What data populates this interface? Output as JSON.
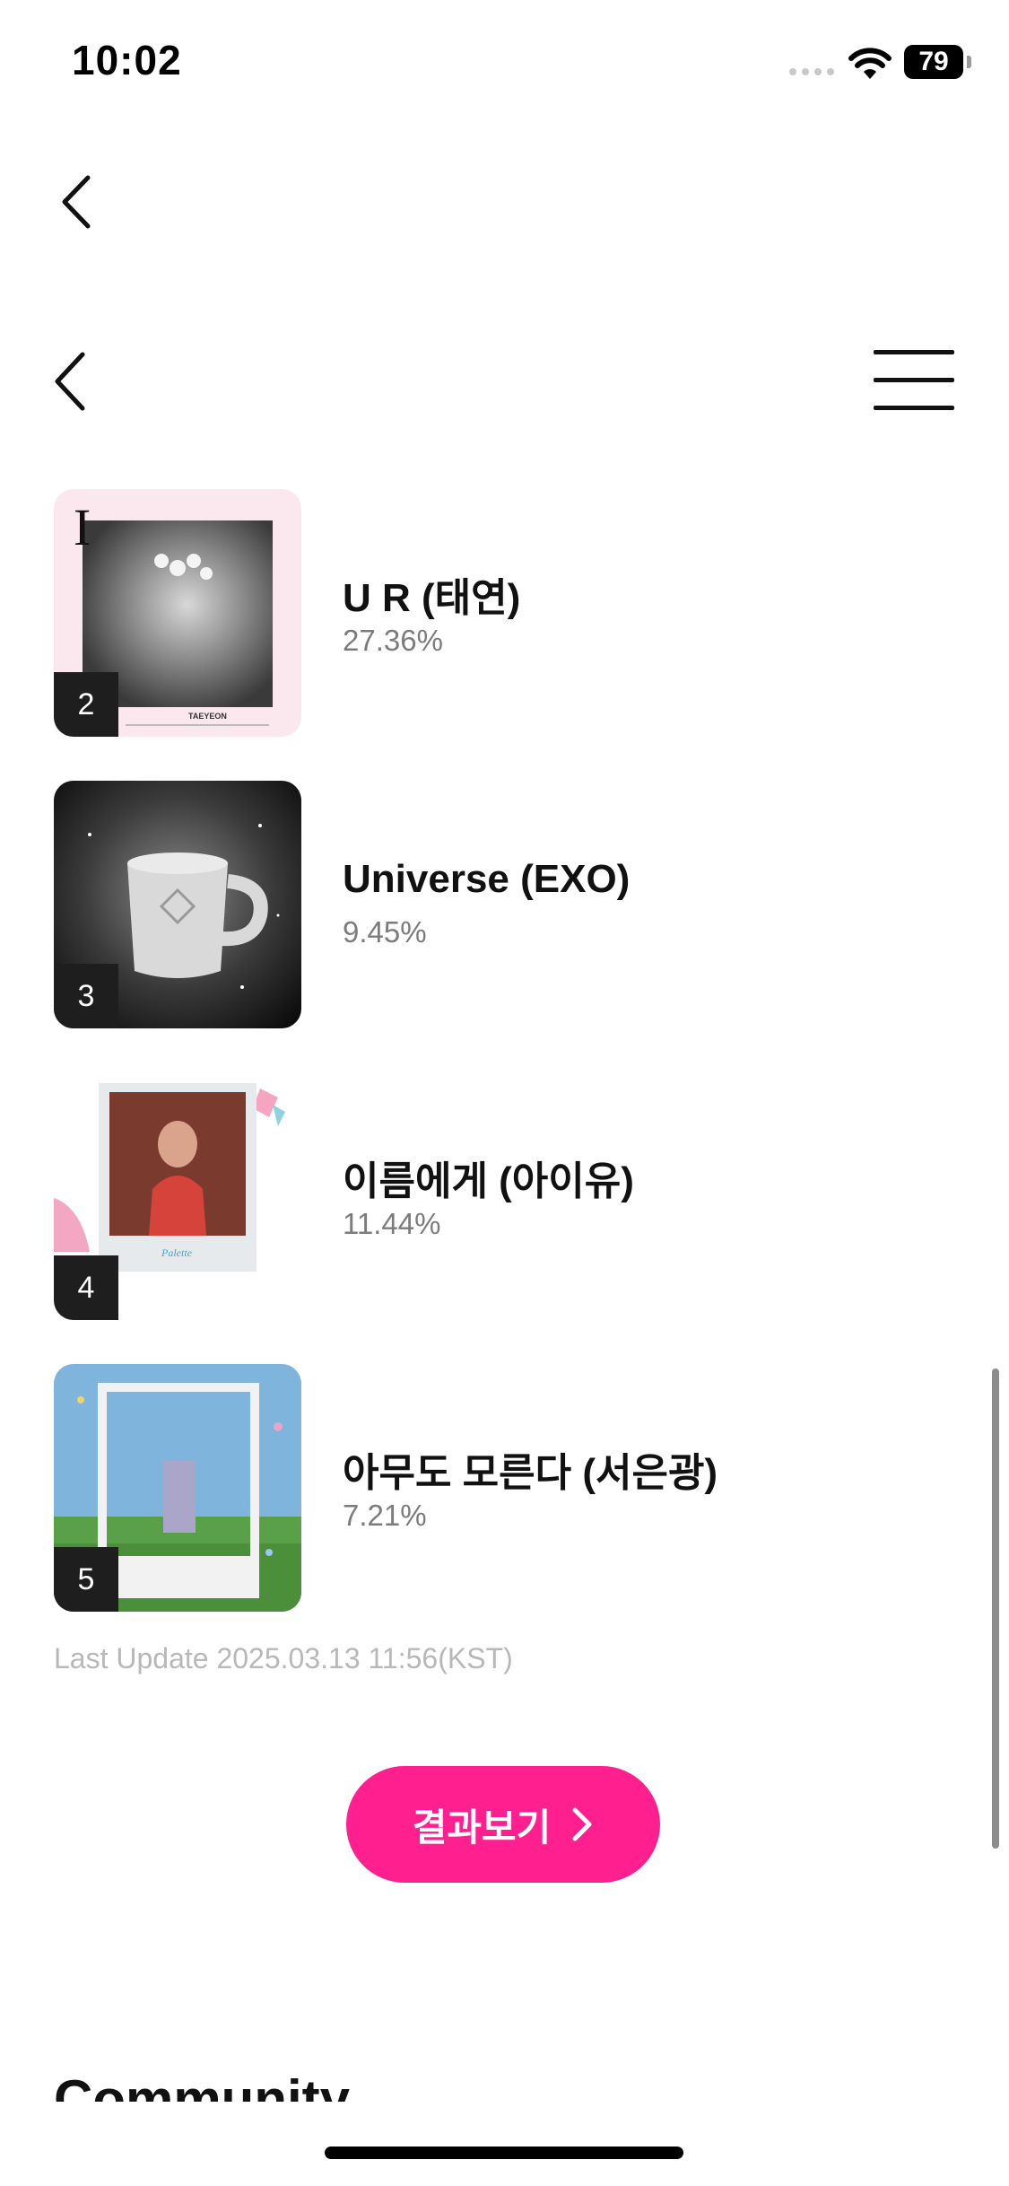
{
  "status_bar": {
    "time": "10:02",
    "battery": "79"
  },
  "chart_items": [
    {
      "rank": "2",
      "title": "U R (태연)",
      "percent": "27.36%"
    },
    {
      "rank": "3",
      "title": "Universe (EXO)",
      "percent": "9.45%"
    },
    {
      "rank": "4",
      "title": "이름에게 (아이유)",
      "percent": "11.44%"
    },
    {
      "rank": "5",
      "title": "아무도 모른다 (서은광)",
      "percent": "7.21%"
    }
  ],
  "album_art": {
    "cover1_letter": "I",
    "cover1_caption": "TAEYEON",
    "cover3_caption": "Palette"
  },
  "last_update": "Last Update 2025.03.13 11:56(KST)",
  "result_button": {
    "label": "결과보기"
  },
  "community_heading": "Community",
  "colors": {
    "accent": "#ff1f8e",
    "badge": "#1e1e1e",
    "muted": "#7c7c7c"
  }
}
